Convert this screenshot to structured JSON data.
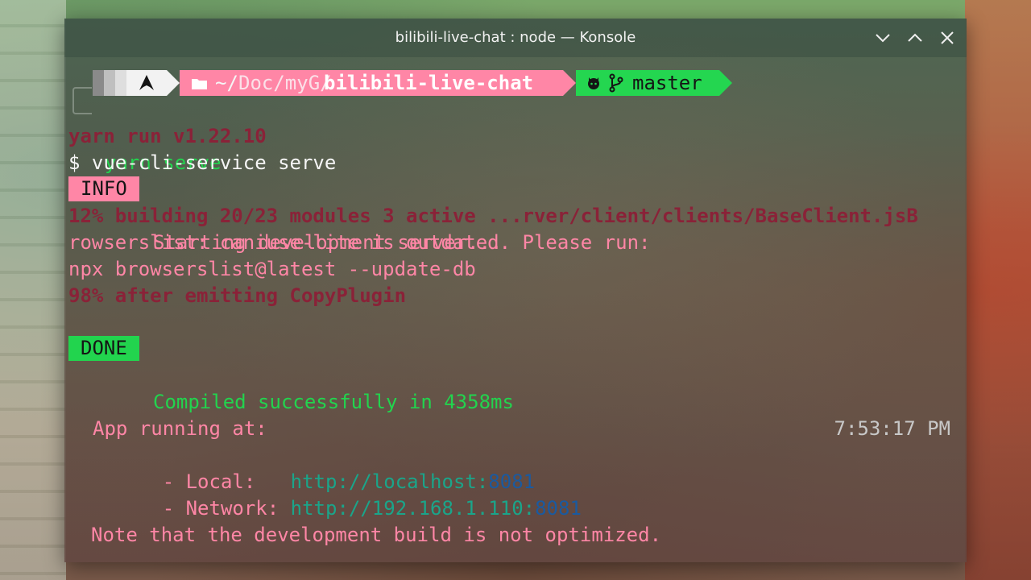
{
  "window": {
    "title": "bilibili-live-chat : node — Konsole"
  },
  "prompt": {
    "os_icon": "arch-linux-icon",
    "folder_icon": "folder-icon",
    "path_prefix": "~/",
    "path_dim": "Doc/myG/",
    "path_current": "bilibili-live-chat",
    "git_icon": "github-icon",
    "branch_icon": "git-branch-icon",
    "branch": "master",
    "colors": {
      "path_segment": "#ff86a6",
      "git_segment": "#24d650"
    }
  },
  "terminal": {
    "command": "yarn serve",
    "yarn_line": "yarn run v1.22.10",
    "dollar_line": "$ vue-cli-service serve",
    "info_badge": "INFO",
    "info_text": "Starting development server...",
    "progress_line": "12% building 20/23 modules 3 active ...rver/client/clients/BaseClient.jsB",
    "browserslist_line1": "rowserslist: caniuse-lite is outdated. Please run:",
    "browserslist_line2": "npx browserslist@latest --update-db",
    "emit_line": "98% after emitting CopyPlugin",
    "done_badge": "DONE",
    "done_text": "Compiled successfully in 4358ms",
    "timestamp": "7:53:17 PM",
    "app_running": "App running at:",
    "local_label": "- Local:   ",
    "local_url_host": "http://localhost:",
    "local_port": "8081",
    "network_label": "- Network: ",
    "network_url_host": "http://192.168.1.110:",
    "network_port": "8081",
    "note": "Note that the development build is not optimized."
  }
}
